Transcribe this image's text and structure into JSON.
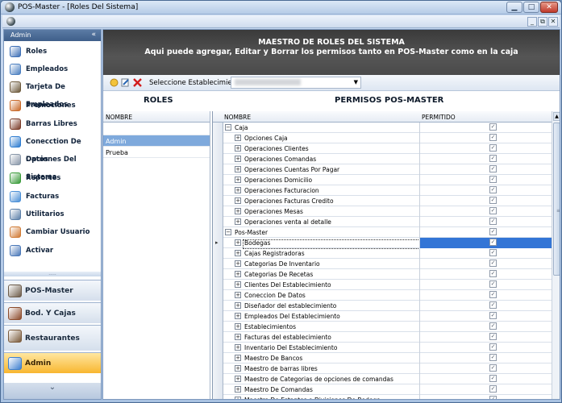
{
  "window": {
    "title": "POS-Master - [Roles Del Sistema]"
  },
  "sidebar": {
    "header": "Admin",
    "collapse_glyph": "«",
    "items": [
      {
        "label": "Roles",
        "icon": "user-icon"
      },
      {
        "label": "Empleados",
        "icon": "id-card-icon"
      },
      {
        "label": "Tarjeta De Empleados",
        "icon": "book-icon"
      },
      {
        "label": "Promociones",
        "icon": "calendar-icon"
      },
      {
        "label": "Barras Libres",
        "icon": "bar-icon"
      },
      {
        "label": "Conecction De Datos",
        "icon": "globe-icon"
      },
      {
        "label": "Opciones Del Sistema",
        "icon": "gears-icon"
      },
      {
        "label": "Reportes",
        "icon": "chart-icon"
      },
      {
        "label": "Facturas",
        "icon": "graph-icon"
      },
      {
        "label": "Utilitarios",
        "icon": "document-icon"
      },
      {
        "label": "Cambiar Usuario",
        "icon": "user-switch-icon"
      },
      {
        "label": "Activar",
        "icon": "handshake-icon"
      }
    ],
    "groups": [
      {
        "label": "POS-Master",
        "icon": "house-icon"
      },
      {
        "label": "Bod. Y Cajas",
        "icon": "cart-icon"
      },
      {
        "label": "Restaurantes",
        "icon": "building-icon"
      },
      {
        "label": "Admin",
        "icon": "chart-line-icon"
      }
    ],
    "footer_glyph": "⌄"
  },
  "banner": {
    "line1": "MAESTRO DE ROLES DEL SISTEMA",
    "line2": "Aqui puede agregar, Editar y Borrar los permisos tanto en POS-Master como en la caja"
  },
  "toolbar": {
    "label": "Seleccione Establecimiento"
  },
  "roles": {
    "title": "ROLES",
    "col_name": "NOMBRE",
    "rows": [
      "Admin",
      "Prueba"
    ]
  },
  "permisos": {
    "title": "PERMISOS POS-MASTER",
    "col_name": "NOMBRE",
    "col_allowed": "PERMITIDO",
    "rows": [
      {
        "label": "Caja",
        "level": 0,
        "node": "minus"
      },
      {
        "label": "Opciones Caja",
        "level": 1,
        "node": "plus"
      },
      {
        "label": "Operaciones Clientes",
        "level": 1,
        "node": "plus"
      },
      {
        "label": "Operaciones Comandas",
        "level": 1,
        "node": "plus"
      },
      {
        "label": "Operaciones Cuentas Por Pagar",
        "level": 1,
        "node": "plus"
      },
      {
        "label": "Operaciones Domicilio",
        "level": 1,
        "node": "plus"
      },
      {
        "label": "Operaciones Facturacion",
        "level": 1,
        "node": "plus"
      },
      {
        "label": "Operaciones Facturas Credito",
        "level": 1,
        "node": "plus"
      },
      {
        "label": "Operaciones Mesas",
        "level": 1,
        "node": "plus"
      },
      {
        "label": "Operaciones venta al detalle",
        "level": 1,
        "node": "plus"
      },
      {
        "label": "Pos-Master",
        "level": 0,
        "node": "minus"
      },
      {
        "label": "Bodegas",
        "level": 1,
        "node": "plus",
        "selected": true
      },
      {
        "label": "Cajas Registradoras",
        "level": 1,
        "node": "plus"
      },
      {
        "label": "Categorias De Inventario",
        "level": 1,
        "node": "plus"
      },
      {
        "label": "Categorias De Recetas",
        "level": 1,
        "node": "plus"
      },
      {
        "label": "Clientes Del Establecimiento",
        "level": 1,
        "node": "plus"
      },
      {
        "label": "Coneccion De Datos",
        "level": 1,
        "node": "plus"
      },
      {
        "label": "Diseñador del establecimiento",
        "level": 1,
        "node": "plus"
      },
      {
        "label": "Empleados Del Establecimiento",
        "level": 1,
        "node": "plus"
      },
      {
        "label": "Establecimientos",
        "level": 1,
        "node": "plus"
      },
      {
        "label": "Facturas del establecimiento",
        "level": 1,
        "node": "plus"
      },
      {
        "label": "Inventario Del Establecimiento",
        "level": 1,
        "node": "plus"
      },
      {
        "label": "Maestro De Bancos",
        "level": 1,
        "node": "plus"
      },
      {
        "label": "Maestro de barras libres",
        "level": 1,
        "node": "plus"
      },
      {
        "label": "Maestro de Categorias de opciones de comandas",
        "level": 1,
        "node": "plus"
      },
      {
        "label": "Maestro De Comandas",
        "level": 1,
        "node": "plus"
      },
      {
        "label": "Maestro De Estantes o Divisiones De Bodega",
        "level": 1,
        "node": "plus"
      }
    ]
  }
}
